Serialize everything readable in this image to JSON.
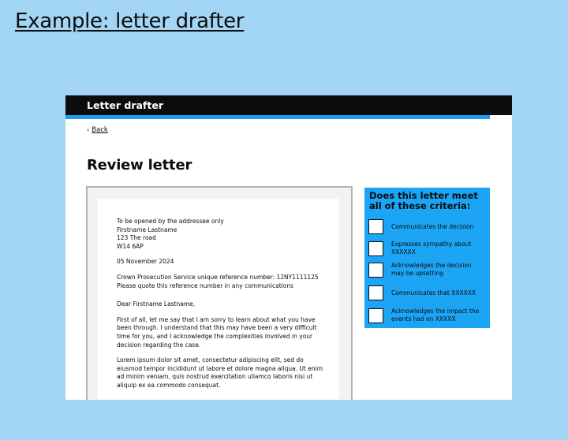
{
  "slide": {
    "title": "Example: letter drafter"
  },
  "app": {
    "header_title": "Letter drafter",
    "back_label": "Back",
    "page_title": "Review letter"
  },
  "letter": {
    "address": "To be opened by the addressee only\nFirstname Lastname\n123 The road\nW14 6AP",
    "date": "05 November 2024",
    "reference": "Crown Prosecution Service unique reference number: 12NY1111125\nPlease quote this reference number in any communications",
    "salutation": "Dear Firstname Lastname,",
    "paragraph1": "First of all, let me say that I am sorry to learn about what you have been through. I understand that this may have been a very difficult time for you, and I acknowledge the complexities involved in your decision regarding the case.",
    "paragraph2": "Lorem ipsum dolor sit amet, consectetur adipiscing elit, sed do eiusmod tempor incididunt ut labore et dolore magna aliqua. Ut enim ad minim veniam, quis nostrud exercitation ullamco laboris nisi ut aliquip ex ea commodo consequat."
  },
  "criteria": {
    "title": "Does this letter meet all of these criteria:",
    "items": [
      {
        "label": "Communicates the decision",
        "checked": false
      },
      {
        "label": "Expresses sympathy about XXXXXX",
        "checked": false
      },
      {
        "label": "Acknowledges the decision may be upsetting",
        "checked": false
      },
      {
        "label": "Communicates that XXXXXX",
        "checked": false
      },
      {
        "label": "Acknowledges the impact the events had on XXXXX",
        "checked": false
      }
    ]
  },
  "colors": {
    "background": "#a3d6f5",
    "header": "#0b0c0c",
    "accent": "#1d9bf0",
    "criteria_panel": "#1ca5f5"
  }
}
